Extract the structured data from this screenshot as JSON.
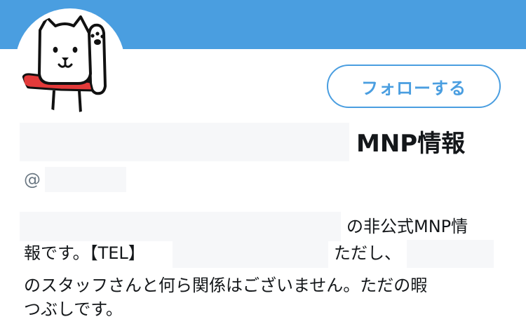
{
  "banner": {
    "color": "#4a9ee0"
  },
  "avatar": {
    "icon": "white-dog-waving-paw"
  },
  "follow_button": {
    "label": "フォローする"
  },
  "profile": {
    "display_name": "MNP情報",
    "handle_prefix": "@"
  },
  "bio": {
    "line1": "の非公式MNP情",
    "line2a": "報です。【TEL】",
    "line2b": "ただし、",
    "line3": "のスタッフさんと何ら関係はございません。ただの暇",
    "line4": "つぶしです。"
  }
}
